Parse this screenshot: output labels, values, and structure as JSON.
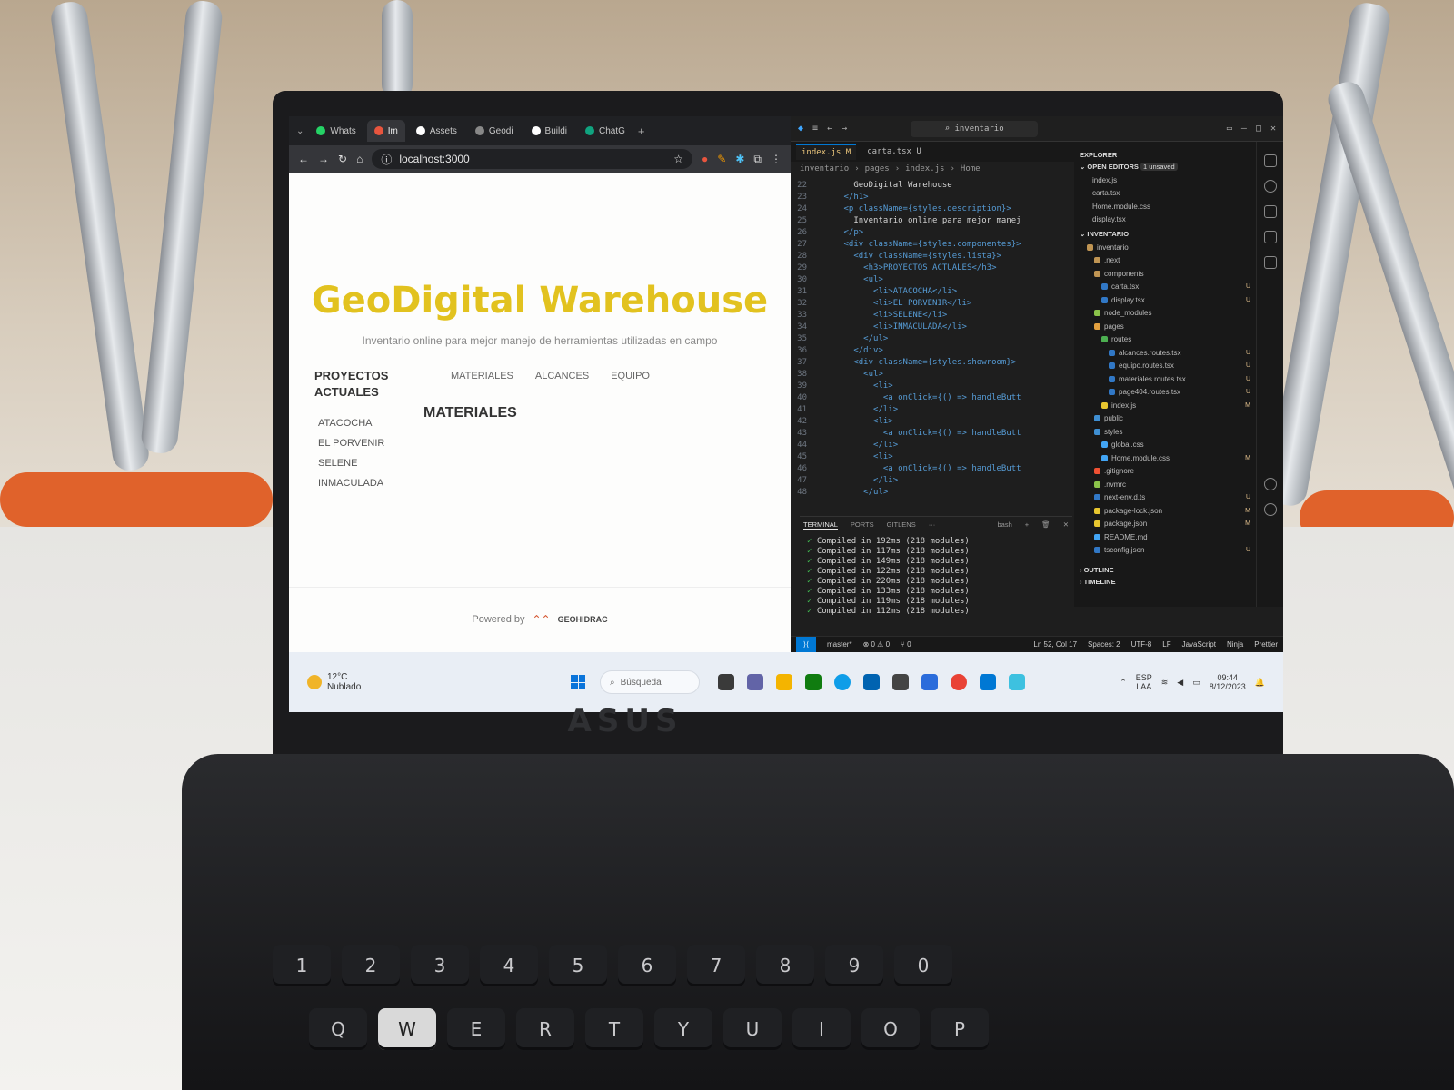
{
  "browser": {
    "tabs": [
      {
        "label": "Whats",
        "color": "#25d366"
      },
      {
        "label": "Im",
        "color": "#e8553e",
        "active": true
      },
      {
        "label": "Assets",
        "color": "#ffffff"
      },
      {
        "label": "Geodi",
        "color": "#888888"
      },
      {
        "label": "Buildi",
        "color": "#ffffff"
      },
      {
        "label": "ChatG",
        "color": "#10a37f"
      }
    ],
    "url": "localhost:3000"
  },
  "site": {
    "title": "GeoDigital Warehouse",
    "description": "Inventario online para mejor manejo de herramientas utilizadas en campo",
    "projects_heading": "PROYECTOS ACTUALES",
    "projects": [
      "ATACOCHA",
      "EL PORVENIR",
      "SELENE",
      "INMACULADA"
    ],
    "nav": [
      "MATERIALES",
      "ALCANCES",
      "EQUIPO"
    ],
    "section_title": "MATERIALES",
    "footer_text": "Powered by",
    "footer_brand": "GEOHIDRAC"
  },
  "vscode": {
    "search": "inventario",
    "tabs": [
      {
        "label": "index.js M",
        "active": true
      },
      {
        "label": "carta.tsx U",
        "active": false
      }
    ],
    "breadcrumb": [
      "inventario",
      "pages",
      "index.js",
      "Home"
    ],
    "code": [
      {
        "n": "22",
        "t": "        GeoDigital Warehouse"
      },
      {
        "n": "23",
        "t": "      </h1>"
      },
      {
        "n": "24",
        "t": "      <p className={styles.description}>"
      },
      {
        "n": "25",
        "t": "        Inventario online para mejor manej"
      },
      {
        "n": "26",
        "t": "      </p>"
      },
      {
        "n": "27",
        "t": "      <div className={styles.componentes}>"
      },
      {
        "n": "28",
        "t": "        <div className={styles.lista}>"
      },
      {
        "n": "29",
        "t": "          <h3>PROYECTOS ACTUALES</h3>"
      },
      {
        "n": "30",
        "t": "          <ul>"
      },
      {
        "n": "31",
        "t": "            <li>ATACOCHA</li>"
      },
      {
        "n": "32",
        "t": "            <li>EL PORVENIR</li>"
      },
      {
        "n": "33",
        "t": "            <li>SELENE</li>"
      },
      {
        "n": "34",
        "t": "            <li>INMACULADA</li>"
      },
      {
        "n": "35",
        "t": "          </ul>"
      },
      {
        "n": "36",
        "t": "        </div>"
      },
      {
        "n": "37",
        "t": "        <div className={styles.showroom}>"
      },
      {
        "n": "38",
        "t": "          <ul>"
      },
      {
        "n": "39",
        "t": "            <li>"
      },
      {
        "n": "40",
        "t": "              <a onClick={() => handleButt"
      },
      {
        "n": "41",
        "t": "            </li>"
      },
      {
        "n": "42",
        "t": "            <li>"
      },
      {
        "n": "43",
        "t": "              <a onClick={() => handleButt"
      },
      {
        "n": "44",
        "t": "            </li>"
      },
      {
        "n": "45",
        "t": "            <li>"
      },
      {
        "n": "46",
        "t": "              <a onClick={() => handleButt"
      },
      {
        "n": "47",
        "t": "            </li>"
      },
      {
        "n": "48",
        "t": "          </ul>"
      }
    ],
    "explorer": {
      "title": "EXPLORER",
      "open_editors": "OPEN EDITORS",
      "unsaved": "1 unsaved",
      "open_files": [
        "index.js",
        "carta.tsx",
        "Home.module.css",
        "display.tsx"
      ],
      "project": "INVENTARIO",
      "tree": [
        {
          "label": "inventario",
          "indent": 1,
          "color": "#c09553"
        },
        {
          "label": ".next",
          "indent": 2,
          "color": "#c09553"
        },
        {
          "label": "components",
          "indent": 2,
          "color": "#c09553"
        },
        {
          "label": "carta.tsx",
          "indent": 3,
          "color": "#3178c6",
          "mark": "U"
        },
        {
          "label": "display.tsx",
          "indent": 3,
          "color": "#3178c6",
          "mark": "U"
        },
        {
          "label": "node_modules",
          "indent": 2,
          "color": "#8bc34a"
        },
        {
          "label": "pages",
          "indent": 2,
          "color": "#e2a03f"
        },
        {
          "label": "routes",
          "indent": 3,
          "color": "#4caf50"
        },
        {
          "label": "alcances.routes.tsx",
          "indent": 4,
          "color": "#3178c6",
          "mark": "U"
        },
        {
          "label": "equipo.routes.tsx",
          "indent": 4,
          "color": "#3178c6",
          "mark": "U"
        },
        {
          "label": "materiales.routes.tsx",
          "indent": 4,
          "color": "#3178c6",
          "mark": "U"
        },
        {
          "label": "page404.routes.tsx",
          "indent": 4,
          "color": "#3178c6",
          "mark": "U"
        },
        {
          "label": "index.js",
          "indent": 3,
          "color": "#e8c62f",
          "mark": "M"
        },
        {
          "label": "public",
          "indent": 2,
          "color": "#3f8fd2"
        },
        {
          "label": "styles",
          "indent": 2,
          "color": "#3f8fd2"
        },
        {
          "label": "global.css",
          "indent": 3,
          "color": "#42a5f5"
        },
        {
          "label": "Home.module.css",
          "indent": 3,
          "color": "#42a5f5",
          "mark": "M"
        },
        {
          "label": ".gitignore",
          "indent": 2,
          "color": "#f05133"
        },
        {
          "label": ".nvmrc",
          "indent": 2,
          "color": "#8bc34a"
        },
        {
          "label": "next-env.d.ts",
          "indent": 2,
          "color": "#3178c6",
          "mark": "U"
        },
        {
          "label": "package-lock.json",
          "indent": 2,
          "color": "#e8c62f",
          "mark": "M"
        },
        {
          "label": "package.json",
          "indent": 2,
          "color": "#e8c62f",
          "mark": "M"
        },
        {
          "label": "README.md",
          "indent": 2,
          "color": "#42a5f5"
        },
        {
          "label": "tsconfig.json",
          "indent": 2,
          "color": "#3178c6",
          "mark": "U"
        }
      ],
      "outline": "OUTLINE",
      "timeline": "TIMELINE"
    },
    "panel": {
      "tabs": [
        "TERMINAL",
        "PORTS",
        "GITLENS"
      ],
      "shell": "bash",
      "lines": [
        "Compiled in 192ms (218 modules)",
        "Compiled in 117ms (218 modules)",
        "Compiled in 149ms (218 modules)",
        "Compiled in 122ms (218 modules)",
        "Compiled in 220ms (218 modules)",
        "Compiled in 133ms (218 modules)",
        "Compiled in 119ms (218 modules)",
        "Compiled in 112ms (218 modules)"
      ]
    },
    "status": {
      "branch": "master*",
      "errors": "0",
      "warnings": "0",
      "ports": "0",
      "position": "Ln 52, Col 17",
      "spaces": "Spaces: 2",
      "encoding": "UTF-8",
      "eol": "LF",
      "language": "JavaScript",
      "ninja": "Ninja",
      "prettier": "Prettier"
    }
  },
  "taskbar": {
    "temp": "12°C",
    "weather": "Nublado",
    "search": "Búsqueda",
    "lang": "ESP",
    "lang2": "LAA",
    "time": "09:44",
    "date": "8/12/2023"
  }
}
